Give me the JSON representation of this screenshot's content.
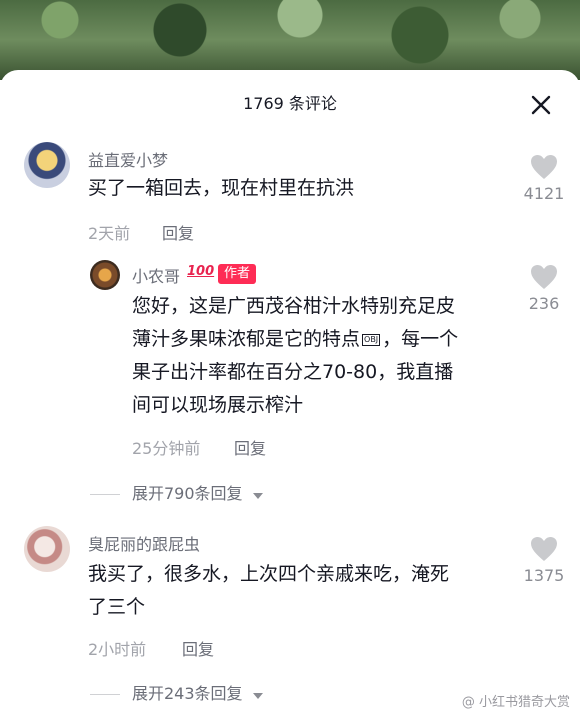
{
  "header": {
    "title": "1769 条评论"
  },
  "comments": [
    {
      "user": "益直爱小梦",
      "text": "买了一箱回去，现在村里在抗洪",
      "time": "2天前",
      "reply_label": "回复",
      "likes": "4121",
      "expand": ""
    },
    {
      "user": "小农哥",
      "badge": "作者",
      "hundred": "100",
      "text_lines": [
        "您好，这是广西茂谷柑汁水特别充足皮",
        "薄汁多果味浓郁是它的特点",
        "果子出汁率都在百分之70-80，我直播",
        "间可以现场展示榨汁"
      ],
      "obj_tag": "OBJ",
      "line2_suffix": "，每一个",
      "time": "25分钟前",
      "reply_label": "回复",
      "likes": "236",
      "expand": "展开790条回复"
    },
    {
      "user": "臭屁丽的跟屁虫",
      "text_lines": [
        "我买了，很多水，上次四个亲戚来吃，淹死",
        "了三个"
      ],
      "time": "2小时前",
      "reply_label": "回复",
      "likes": "1375",
      "expand": "展开243条回复"
    }
  ],
  "watermark": "@ 小红书猎奇大赏"
}
